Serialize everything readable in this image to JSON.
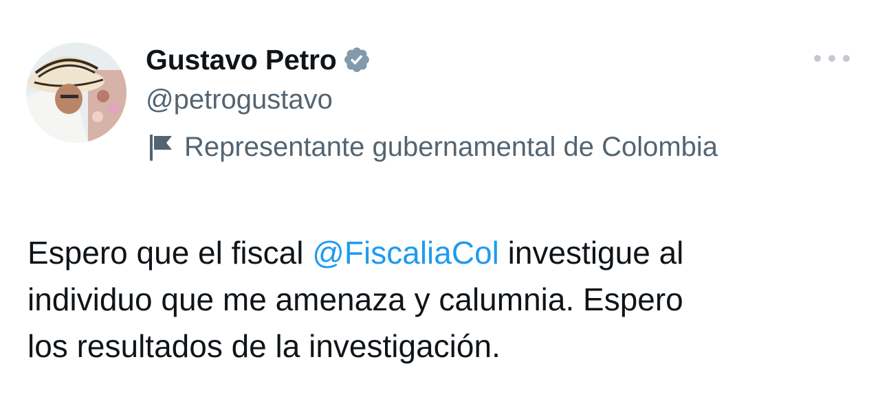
{
  "author": {
    "display_name": "Gustavo Petro",
    "handle": "@petrogustavo",
    "verified": true,
    "affiliation": "Representante gubernamental de Colombia"
  },
  "tweet": {
    "text_part1": "Espero que el fiscal ",
    "mention": "@FiscaliaCol",
    "text_line1_end": " investigue al",
    "text_line2": "individuo que me amenaza y calumnia. Espero",
    "text_line3": "los resultados de la investigación."
  },
  "icons": {
    "verified": "verified-badge-icon",
    "affiliation": "flag-icon",
    "more": "more-options-icon"
  },
  "colors": {
    "mention": "#1d9bf0",
    "secondary_text": "#536471",
    "verified_badge": "#829aab"
  }
}
